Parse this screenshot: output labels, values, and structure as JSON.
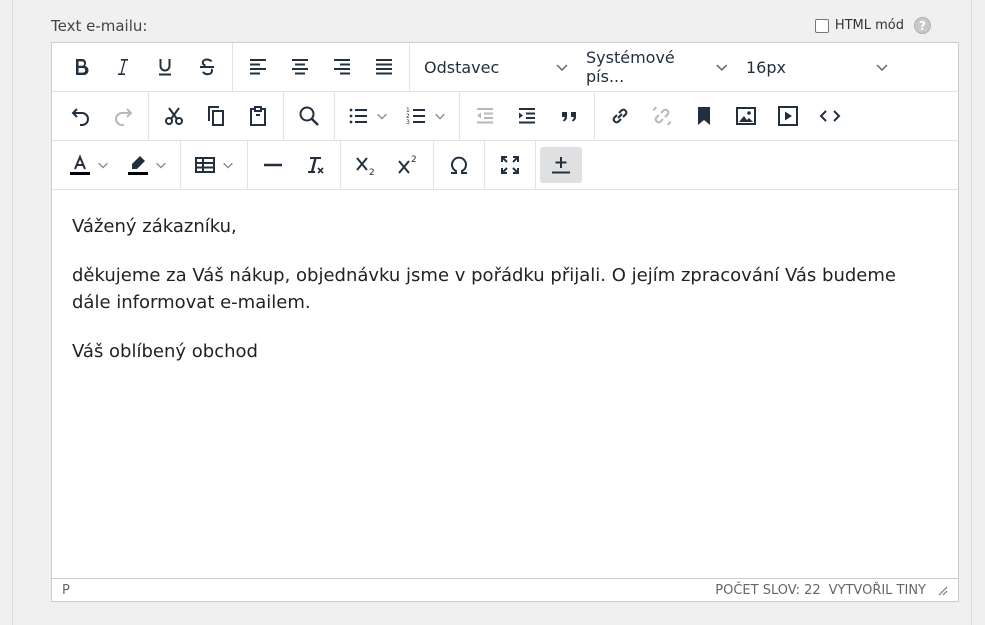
{
  "field_label": "Text e-mailu:",
  "html_mode": {
    "label": "HTML mód",
    "checked": false,
    "help": "?"
  },
  "toolbar": {
    "block_format": "Odstavec",
    "font_family": "Systémové pís...",
    "font_size": "16px"
  },
  "content": {
    "paragraphs": [
      "Vážený zákazníku,",
      "děkujeme za Váš nákup, objednávku jsme v pořádku přijali. O jejím zpracování Vás budeme dále informovat e-mailem.",
      "Váš oblíbený obchod"
    ]
  },
  "statusbar": {
    "path": "P",
    "word_count": "POČET SLOV: 22",
    "brand": "VYTVOŘIL TINY"
  }
}
